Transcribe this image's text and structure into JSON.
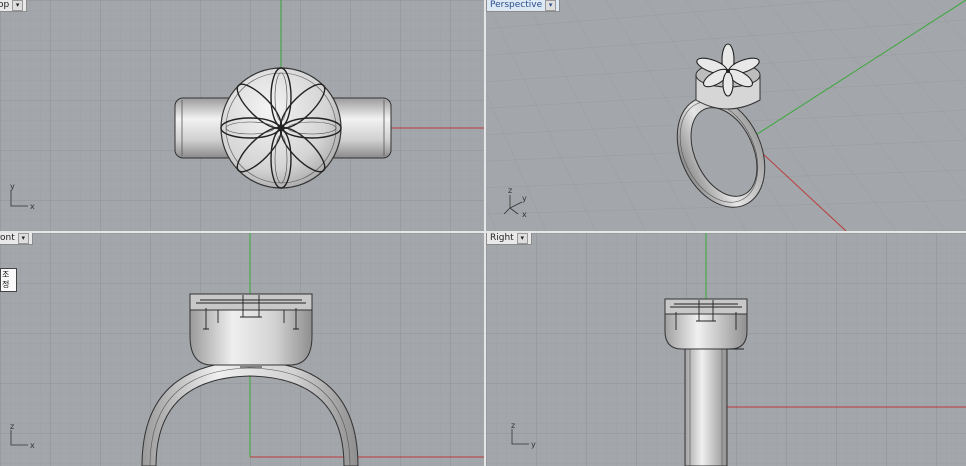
{
  "viewports": {
    "top": {
      "label": "Top"
    },
    "perspective": {
      "label": "Perspective"
    },
    "front": {
      "label": "Front"
    },
    "right": {
      "label": "Right"
    }
  },
  "axis_labels": {
    "x": "x",
    "y": "y",
    "z": "z"
  },
  "tooltip": {
    "line1": "조정",
    "line2": "조정"
  },
  "colors": {
    "viewport_bg": "#a3a6aa",
    "grid_minor": "#9a9da1",
    "grid_major": "#8c8f93",
    "x_axis": "#b83a3a",
    "y_axis": "#3aa83a",
    "model": "#d8d8d8",
    "outline": "#333333"
  }
}
